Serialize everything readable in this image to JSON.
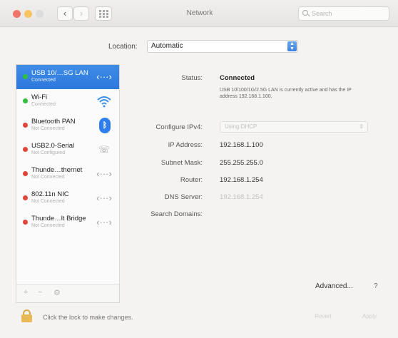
{
  "window": {
    "title": "Network"
  },
  "toolbar": {
    "back_label": "‹",
    "fwd_label": "›",
    "search_placeholder": "Search"
  },
  "location": {
    "label": "Location:",
    "value": "Automatic"
  },
  "services": [
    {
      "name": "USB 10/…SG LAN",
      "status": "Connected",
      "icon": "ethernet-arrows-icon",
      "dot": "#2fbf3a"
    },
    {
      "name": "Wi-Fi",
      "status": "Connected",
      "icon": "wifi-icon",
      "dot": "#2fbf3a"
    },
    {
      "name": "Bluetooth PAN",
      "status": "Not Connected",
      "icon": "bluetooth-icon",
      "dot": "#e0453a"
    },
    {
      "name": "USB2.0-Serial",
      "status": "Not Configured",
      "icon": "phone-icon",
      "dot": "#e0453a"
    },
    {
      "name": "Thunde…thernet",
      "status": "Not Connected",
      "icon": "ethernet-arrows-icon",
      "dot": "#e0453a"
    },
    {
      "name": "802.11n NIC",
      "status": "Not Connected",
      "icon": "ethernet-arrows-icon",
      "dot": "#e0453a"
    },
    {
      "name": "Thunde…lt Bridge",
      "status": "Not Connected",
      "icon": "ethernet-arrows-icon",
      "dot": "#e0453a"
    }
  ],
  "sidebar_tools": {
    "add": "+",
    "remove": "−",
    "gear": "⚙"
  },
  "detail": {
    "status_label": "Status:",
    "status_value": "Connected",
    "status_desc": "USB 10/100/1G/2.5G LAN is currently active and has the IP address 192.168.1.100.",
    "configure_label": "Configure IPv4:",
    "configure_value": "Using DHCP",
    "ip_label": "IP Address:",
    "ip_value": "192.168.1.100",
    "subnet_label": "Subnet Mask:",
    "subnet_value": "255.255.255.0",
    "router_label": "Router:",
    "router_value": "192.168.1.254",
    "dns_label": "DNS Server:",
    "dns_value": "192.168.1.254",
    "search_domains_label": "Search Domains:",
    "advanced_label": "Advanced...",
    "help_label": "?"
  },
  "footer": {
    "lock_text": "Click the lock to make changes.",
    "revert_label": "Revert",
    "apply_label": "Apply"
  },
  "colors": {
    "accent": "#2d78dc",
    "connected": "#2fbf3a",
    "disconnected": "#e0453a"
  }
}
